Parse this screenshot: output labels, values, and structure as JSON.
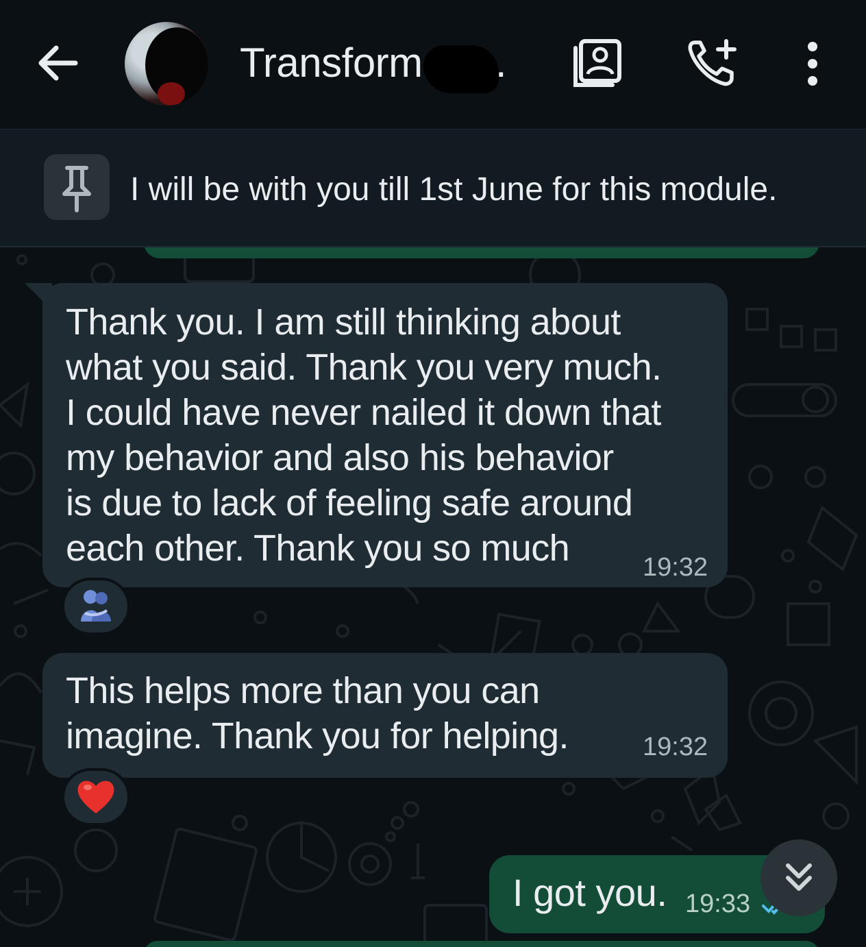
{
  "header": {
    "title": "Transform M…",
    "back_icon": "arrow-left-icon",
    "avatar_icon": "contact-avatar",
    "video_icon": "contact-card-icon",
    "call_icon": "add-call-icon",
    "menu_icon": "more-vert-icon"
  },
  "pinned": {
    "icon": "pin-icon",
    "text": "I will be with you till 1st June for this module."
  },
  "messages": [
    {
      "direction": "incoming",
      "text": "Thank you. I am still thinking about\nwhat you said. Thank you very much.\nI could have never nailed it down that\nmy behavior and also his behavior\nis due to lack of feeling safe around\neach other. Thank you so much",
      "time": "19:32",
      "reaction": "hug-emoji"
    },
    {
      "direction": "incoming",
      "text": "This helps more than you can\nimagine. Thank you for helping.",
      "time": "19:32",
      "reaction": "red-heart-emoji"
    },
    {
      "direction": "outgoing",
      "text": "I got you.",
      "time": "19:33",
      "status_icon": "double-check-icon"
    }
  ],
  "scroll_button": {
    "icon": "double-chevron-down-icon"
  },
  "colors": {
    "background": "#0b1014",
    "incoming_bubble": "#1f2c33",
    "outgoing_bubble": "#144d37",
    "text": "#e9edef",
    "read_tick": "#53bdeb"
  }
}
